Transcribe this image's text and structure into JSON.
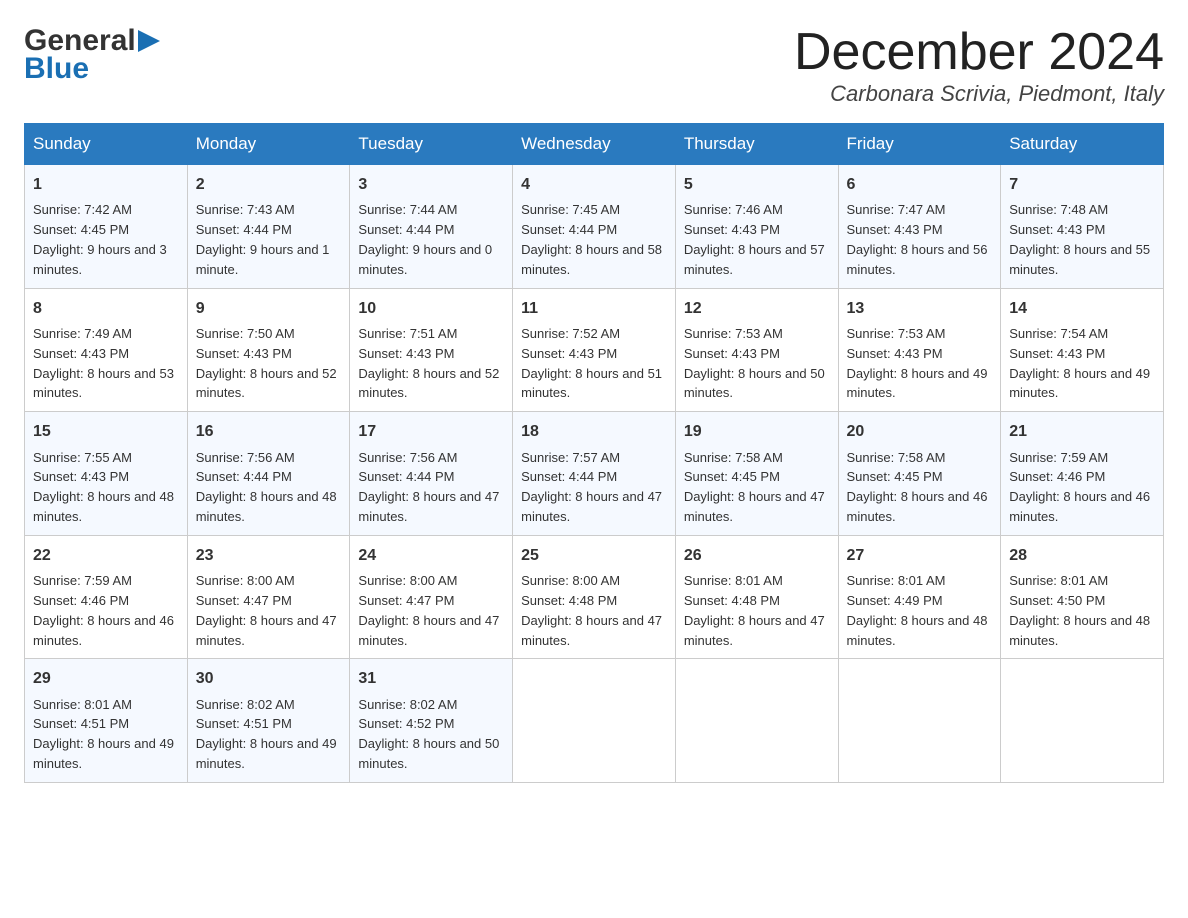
{
  "header": {
    "logo_general": "General",
    "logo_blue": "Blue",
    "month_title": "December 2024",
    "location": "Carbonara Scrivia, Piedmont, Italy"
  },
  "days_of_week": [
    "Sunday",
    "Monday",
    "Tuesday",
    "Wednesday",
    "Thursday",
    "Friday",
    "Saturday"
  ],
  "weeks": [
    [
      {
        "num": "1",
        "sunrise": "7:42 AM",
        "sunset": "4:45 PM",
        "daylight": "9 hours and 3 minutes."
      },
      {
        "num": "2",
        "sunrise": "7:43 AM",
        "sunset": "4:44 PM",
        "daylight": "9 hours and 1 minute."
      },
      {
        "num": "3",
        "sunrise": "7:44 AM",
        "sunset": "4:44 PM",
        "daylight": "9 hours and 0 minutes."
      },
      {
        "num": "4",
        "sunrise": "7:45 AM",
        "sunset": "4:44 PM",
        "daylight": "8 hours and 58 minutes."
      },
      {
        "num": "5",
        "sunrise": "7:46 AM",
        "sunset": "4:43 PM",
        "daylight": "8 hours and 57 minutes."
      },
      {
        "num": "6",
        "sunrise": "7:47 AM",
        "sunset": "4:43 PM",
        "daylight": "8 hours and 56 minutes."
      },
      {
        "num": "7",
        "sunrise": "7:48 AM",
        "sunset": "4:43 PM",
        "daylight": "8 hours and 55 minutes."
      }
    ],
    [
      {
        "num": "8",
        "sunrise": "7:49 AM",
        "sunset": "4:43 PM",
        "daylight": "8 hours and 53 minutes."
      },
      {
        "num": "9",
        "sunrise": "7:50 AM",
        "sunset": "4:43 PM",
        "daylight": "8 hours and 52 minutes."
      },
      {
        "num": "10",
        "sunrise": "7:51 AM",
        "sunset": "4:43 PM",
        "daylight": "8 hours and 52 minutes."
      },
      {
        "num": "11",
        "sunrise": "7:52 AM",
        "sunset": "4:43 PM",
        "daylight": "8 hours and 51 minutes."
      },
      {
        "num": "12",
        "sunrise": "7:53 AM",
        "sunset": "4:43 PM",
        "daylight": "8 hours and 50 minutes."
      },
      {
        "num": "13",
        "sunrise": "7:53 AM",
        "sunset": "4:43 PM",
        "daylight": "8 hours and 49 minutes."
      },
      {
        "num": "14",
        "sunrise": "7:54 AM",
        "sunset": "4:43 PM",
        "daylight": "8 hours and 49 minutes."
      }
    ],
    [
      {
        "num": "15",
        "sunrise": "7:55 AM",
        "sunset": "4:43 PM",
        "daylight": "8 hours and 48 minutes."
      },
      {
        "num": "16",
        "sunrise": "7:56 AM",
        "sunset": "4:44 PM",
        "daylight": "8 hours and 48 minutes."
      },
      {
        "num": "17",
        "sunrise": "7:56 AM",
        "sunset": "4:44 PM",
        "daylight": "8 hours and 47 minutes."
      },
      {
        "num": "18",
        "sunrise": "7:57 AM",
        "sunset": "4:44 PM",
        "daylight": "8 hours and 47 minutes."
      },
      {
        "num": "19",
        "sunrise": "7:58 AM",
        "sunset": "4:45 PM",
        "daylight": "8 hours and 47 minutes."
      },
      {
        "num": "20",
        "sunrise": "7:58 AM",
        "sunset": "4:45 PM",
        "daylight": "8 hours and 46 minutes."
      },
      {
        "num": "21",
        "sunrise": "7:59 AM",
        "sunset": "4:46 PM",
        "daylight": "8 hours and 46 minutes."
      }
    ],
    [
      {
        "num": "22",
        "sunrise": "7:59 AM",
        "sunset": "4:46 PM",
        "daylight": "8 hours and 46 minutes."
      },
      {
        "num": "23",
        "sunrise": "8:00 AM",
        "sunset": "4:47 PM",
        "daylight": "8 hours and 47 minutes."
      },
      {
        "num": "24",
        "sunrise": "8:00 AM",
        "sunset": "4:47 PM",
        "daylight": "8 hours and 47 minutes."
      },
      {
        "num": "25",
        "sunrise": "8:00 AM",
        "sunset": "4:48 PM",
        "daylight": "8 hours and 47 minutes."
      },
      {
        "num": "26",
        "sunrise": "8:01 AM",
        "sunset": "4:48 PM",
        "daylight": "8 hours and 47 minutes."
      },
      {
        "num": "27",
        "sunrise": "8:01 AM",
        "sunset": "4:49 PM",
        "daylight": "8 hours and 48 minutes."
      },
      {
        "num": "28",
        "sunrise": "8:01 AM",
        "sunset": "4:50 PM",
        "daylight": "8 hours and 48 minutes."
      }
    ],
    [
      {
        "num": "29",
        "sunrise": "8:01 AM",
        "sunset": "4:51 PM",
        "daylight": "8 hours and 49 minutes."
      },
      {
        "num": "30",
        "sunrise": "8:02 AM",
        "sunset": "4:51 PM",
        "daylight": "8 hours and 49 minutes."
      },
      {
        "num": "31",
        "sunrise": "8:02 AM",
        "sunset": "4:52 PM",
        "daylight": "8 hours and 50 minutes."
      },
      null,
      null,
      null,
      null
    ]
  ],
  "labels": {
    "sunrise": "Sunrise:",
    "sunset": "Sunset:",
    "daylight": "Daylight:"
  }
}
